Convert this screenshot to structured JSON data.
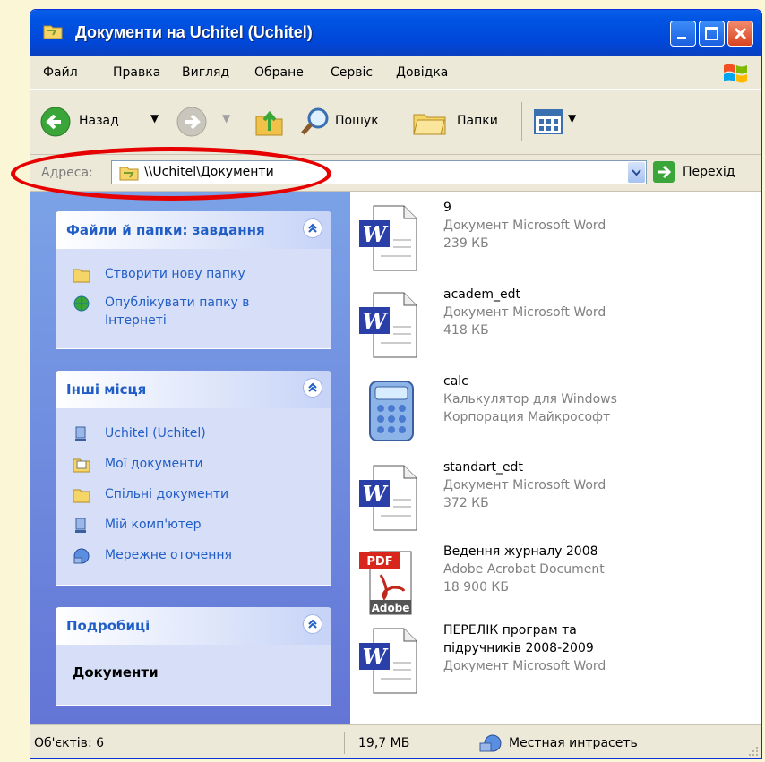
{
  "window": {
    "title": "Документи на Uchitel (Uchitel)"
  },
  "menu": [
    "Файл",
    "Правка",
    "Вигляд",
    "Обране",
    "Сервіс",
    "Довідка"
  ],
  "toolbar": {
    "back_label": "Назад",
    "search_label": "Пошук",
    "folders_label": "Папки"
  },
  "address": {
    "label": "Адреса:",
    "value": "\\\\Uchitel\\Документи",
    "go_label": "Перехід"
  },
  "tasks_panel": {
    "title": "Файли й папки: завдання",
    "items": [
      {
        "label": "Створити нову папку",
        "icon": "new-folder-icon"
      },
      {
        "label": "Опублікувати папку в",
        "label2": "Інтернеті",
        "icon": "publish-web-icon"
      }
    ]
  },
  "places_panel": {
    "title": "Інші місця",
    "items": [
      {
        "label": "Uchitel (Uchitel)",
        "icon": "computer-icon"
      },
      {
        "label": "Мої документи",
        "icon": "my-documents-icon"
      },
      {
        "label": "Спільні документи",
        "icon": "shared-folder-icon"
      },
      {
        "label": "Мій комп'ютер",
        "icon": "my-computer-icon"
      },
      {
        "label": "Мережне оточення",
        "icon": "network-icon"
      }
    ]
  },
  "details_panel": {
    "title": "Подробиці",
    "name": "Документи"
  },
  "files": [
    {
      "name": "9",
      "line2": "Документ Microsoft Word",
      "line3": "239 КБ",
      "icon": "word-document-icon"
    },
    {
      "name": "academ_edt",
      "line2": "Документ Microsoft Word",
      "line3": "418 КБ",
      "icon": "word-document-icon"
    },
    {
      "name": "calc",
      "line2": "Калькулятор для Windows",
      "line3": "Корпорация Майкрософт",
      "icon": "calculator-icon"
    },
    {
      "name": "standart_edt",
      "line2": "Документ Microsoft Word",
      "line3": "372 КБ",
      "icon": "word-document-icon"
    },
    {
      "name": "Ведення журналу 2008",
      "line2": "Adobe Acrobat Document",
      "line3": "18 900 КБ",
      "icon": "pdf-document-icon"
    },
    {
      "name": "ПЕРЕЛІК програм та",
      "line2": "підручників 2008-2009",
      "line3": "Документ Microsoft Word",
      "icon": "word-document-icon"
    }
  ],
  "status": {
    "objects": "Об'єктів: 6",
    "size": "19,7 МБ",
    "zone": "Местная интрасеть"
  },
  "colors": {
    "title_bar": "#0054e3",
    "sidebar": "#6375d6",
    "highlight_ellipse": "#e60000"
  }
}
